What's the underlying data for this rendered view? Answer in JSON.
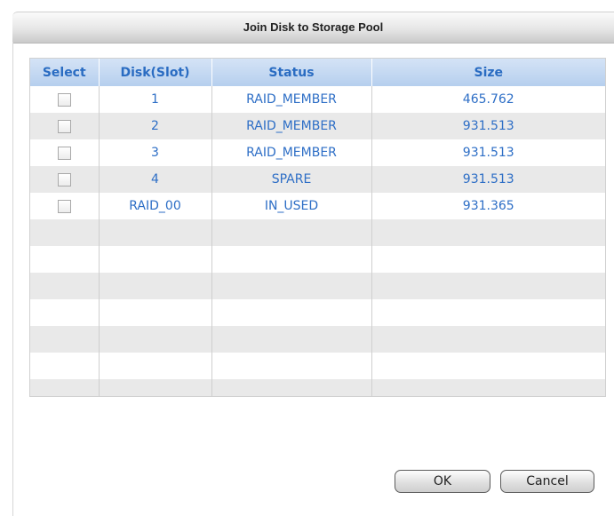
{
  "dialog": {
    "title": "Join Disk to Storage Pool"
  },
  "table": {
    "columns": [
      "Select",
      "Disk(Slot)",
      "Status",
      "Size"
    ],
    "rows": [
      {
        "disk": "1",
        "status": "RAID_MEMBER",
        "size": "465.762"
      },
      {
        "disk": "2",
        "status": "RAID_MEMBER",
        "size": "931.513"
      },
      {
        "disk": "3",
        "status": "RAID_MEMBER",
        "size": "931.513"
      },
      {
        "disk": "4",
        "status": "SPARE",
        "size": "931.513"
      },
      {
        "disk": "RAID_00",
        "status": "IN_USED",
        "size": "931.365"
      }
    ]
  },
  "buttons": {
    "ok": "OK",
    "cancel": "Cancel"
  }
}
